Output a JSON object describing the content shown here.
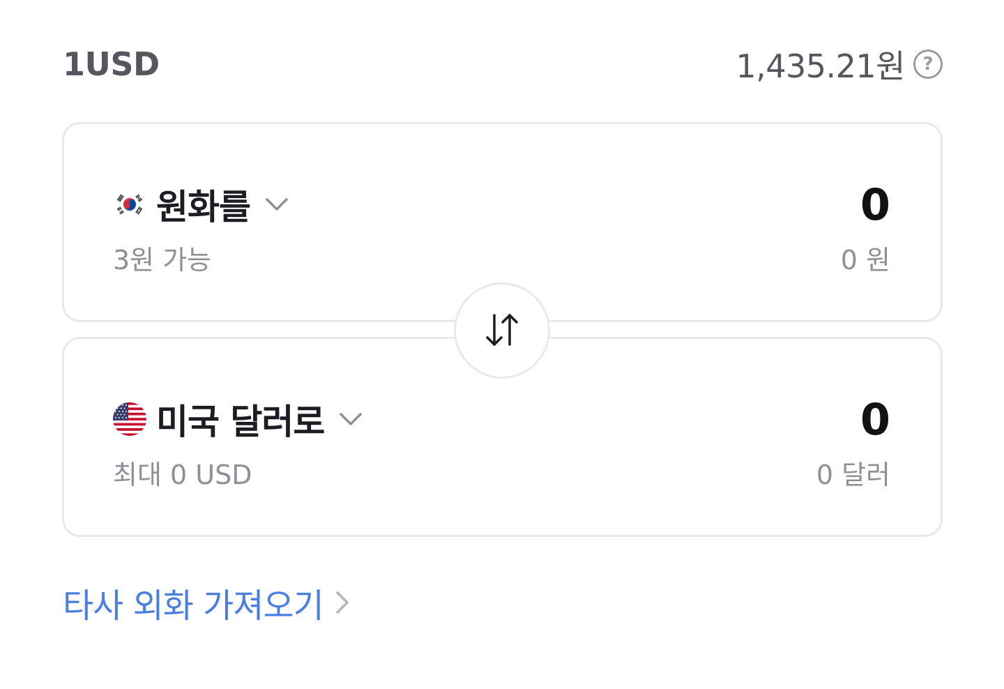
{
  "rate": {
    "base_unit": "1USD",
    "value": "1,435.21원",
    "help_icon": "question-circle-icon"
  },
  "from_card": {
    "flag_icon": "korea-flag-icon",
    "currency_label": "원화를",
    "amount": "0",
    "available": "3원 가능",
    "converted": "0 원"
  },
  "to_card": {
    "flag_icon": "us-flag-icon",
    "currency_label": "미국 달러로",
    "amount": "0",
    "max": "최대 0 USD",
    "converted": "0 달러"
  },
  "swap": {
    "icon": "swap-vertical-icon"
  },
  "import_link": {
    "label": "타사 외화 가져오기",
    "color": "#4a7ee0"
  }
}
